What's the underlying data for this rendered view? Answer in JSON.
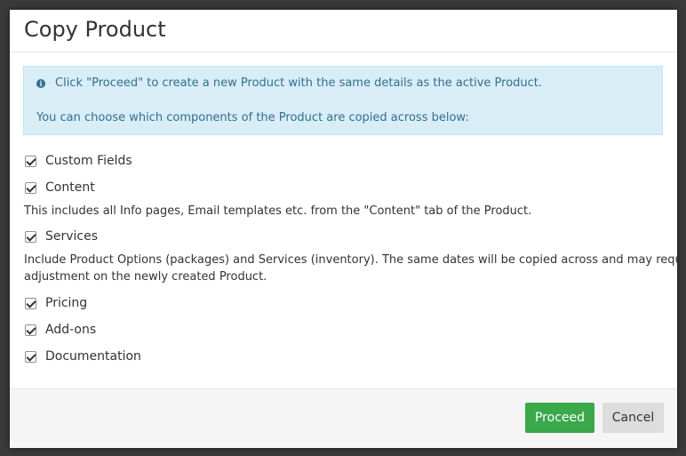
{
  "dialog": {
    "title": "Copy Product",
    "info": {
      "icon": "info-circle-icon",
      "line1": "Click \"Proceed\" to create a new Product with the same details as the active Product.",
      "line2": "You can choose which components of the Product are copied across below:"
    },
    "options": [
      {
        "label": "Custom Fields",
        "checked": true
      },
      {
        "label": "Content",
        "checked": true,
        "help": "This includes all Info pages, Email templates etc. from the \"Content\" tab of the Product."
      },
      {
        "label": "Services",
        "checked": true,
        "help_line1": "Include Product Options (packages) and Services (inventory). The same dates will be copied across and may require",
        "help_line2": "adjustment on the newly created Product."
      },
      {
        "label": "Pricing",
        "checked": true
      },
      {
        "label": "Add-ons",
        "checked": true
      },
      {
        "label": "Documentation",
        "checked": true
      }
    ],
    "buttons": {
      "proceed": "Proceed",
      "cancel": "Cancel"
    }
  },
  "colors": {
    "proceed_bg": "#3aa84b",
    "alert_bg": "#d9edf7",
    "alert_text": "#31708f"
  }
}
